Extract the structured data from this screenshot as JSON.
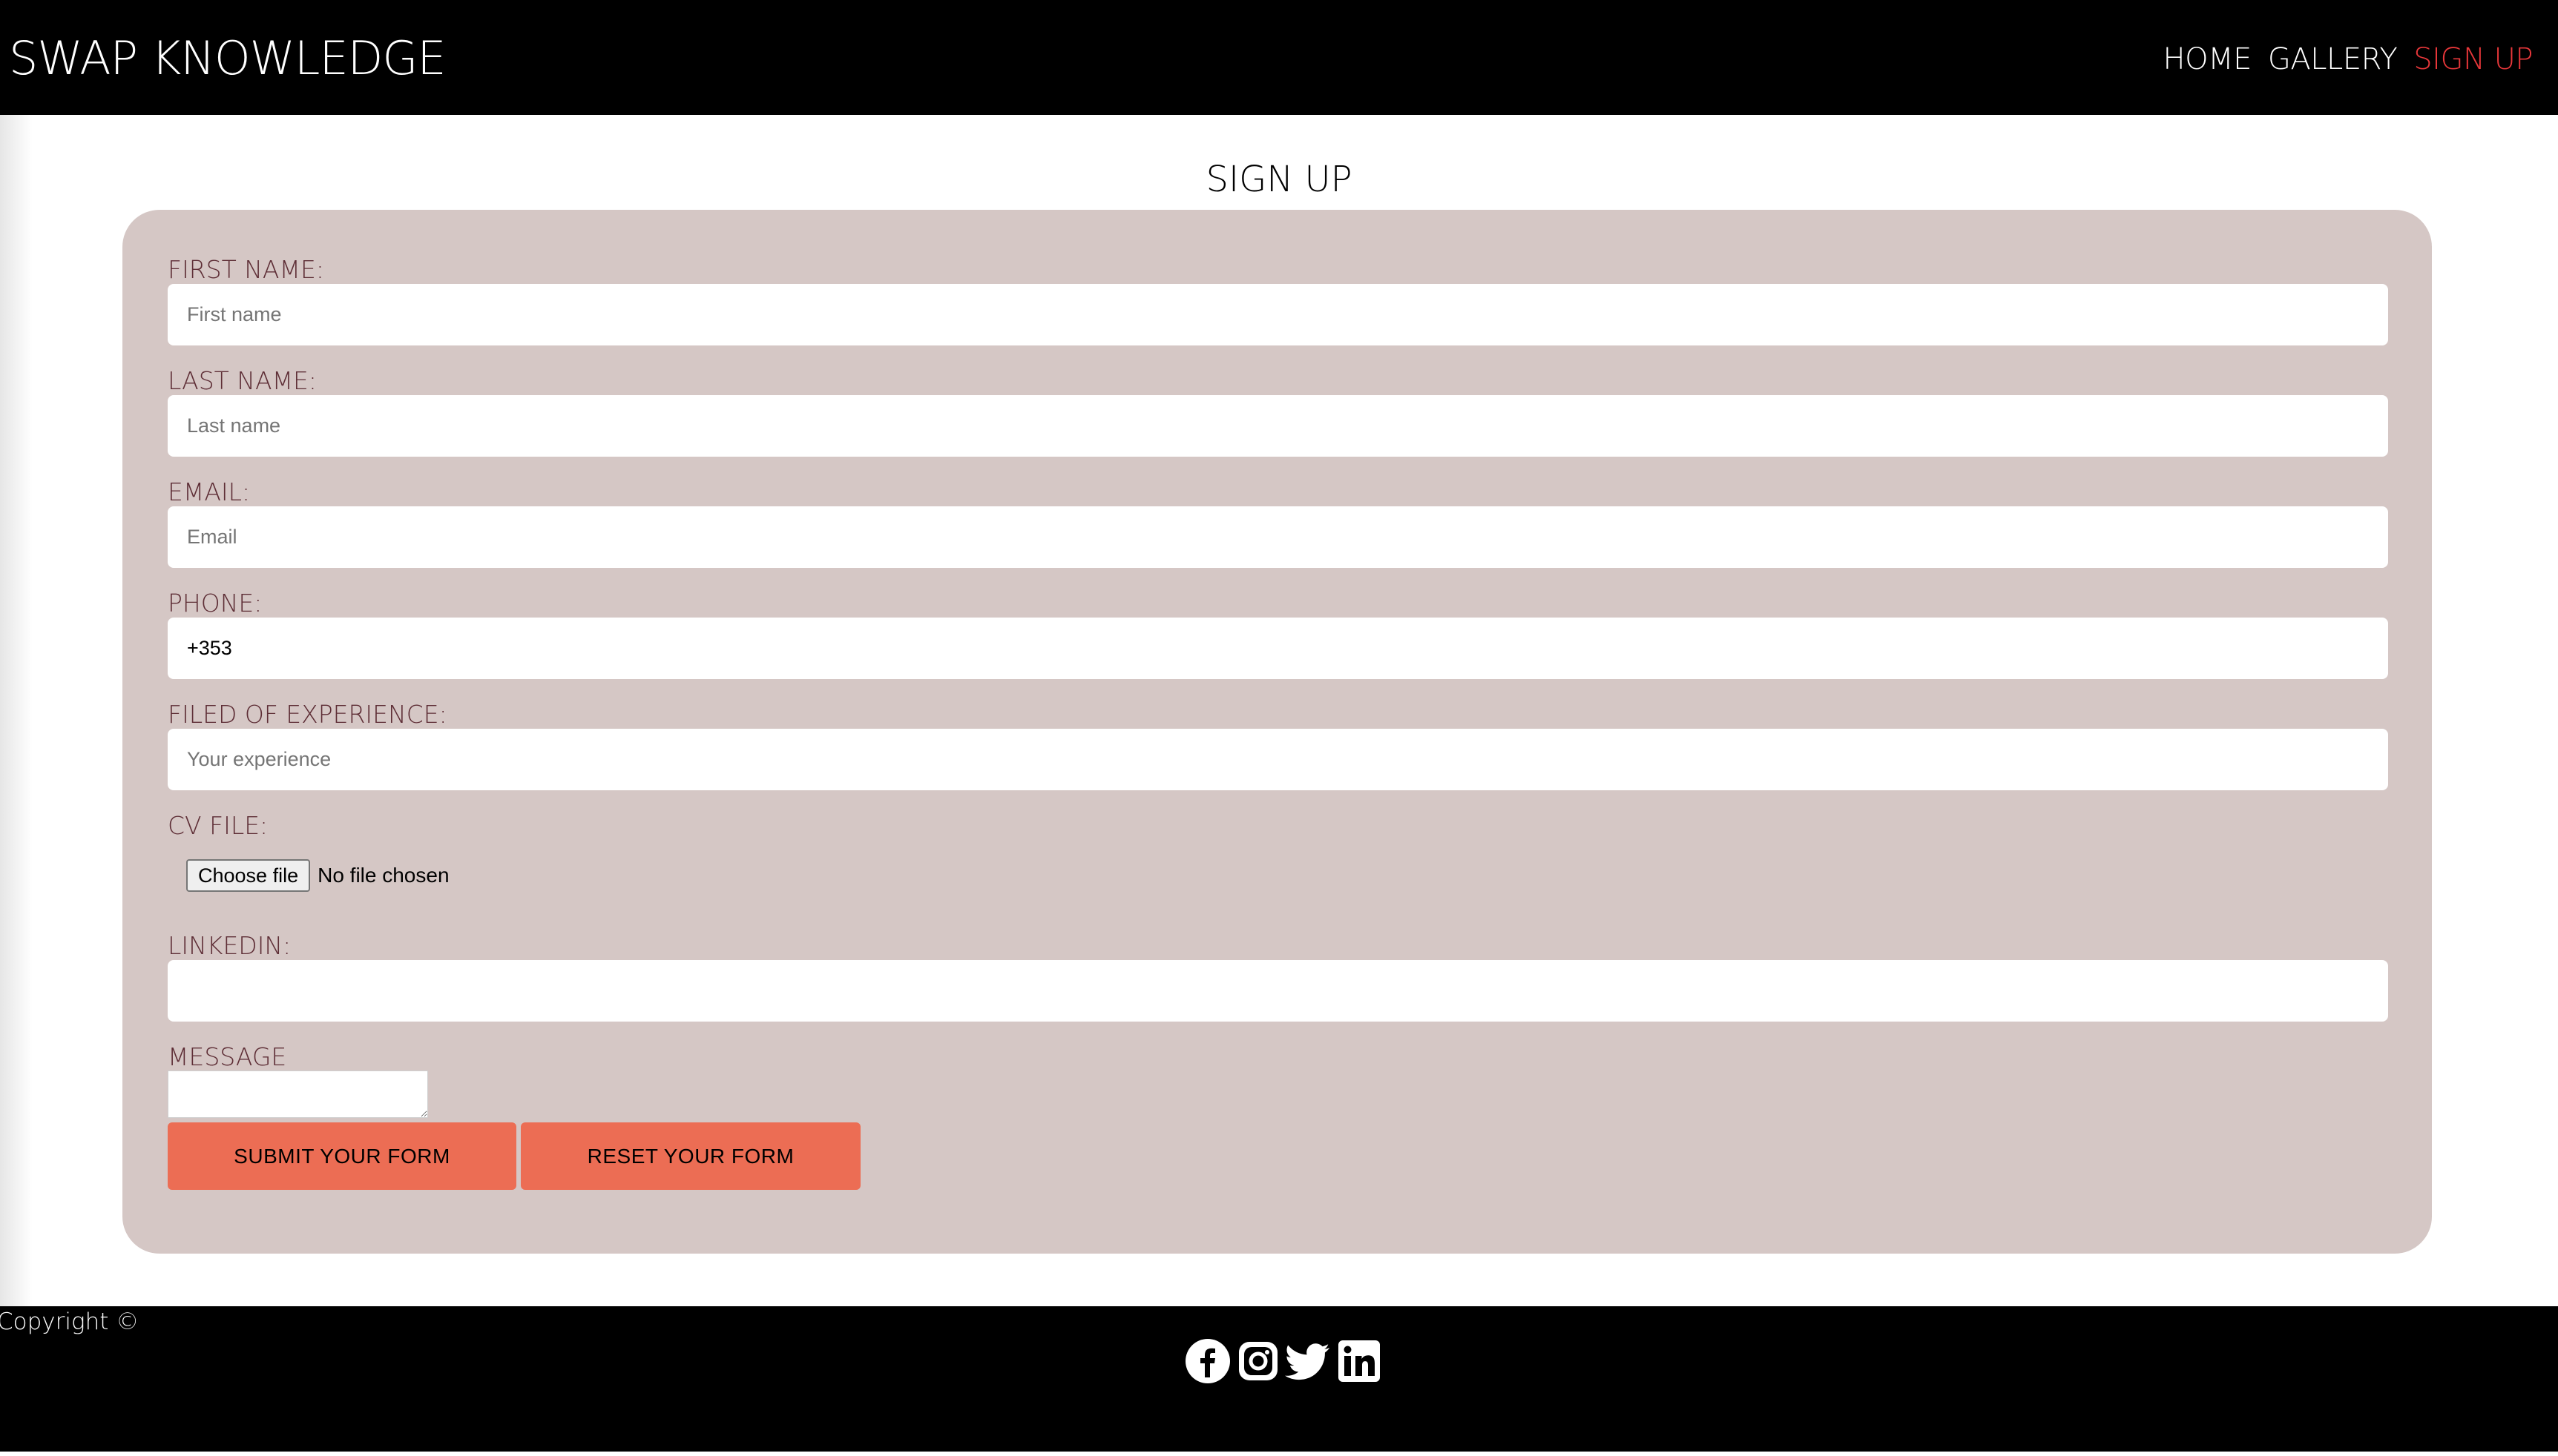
{
  "header": {
    "brand": "SWAP KNOWLEDGE",
    "nav": [
      {
        "label": "HOME",
        "active": false
      },
      {
        "label": "GALLERY",
        "active": false
      },
      {
        "label": "SIGN UP",
        "active": true
      }
    ]
  },
  "page_title": "SIGN UP",
  "form": {
    "first_name": {
      "label": "FIRST NAME:",
      "placeholder": "First name",
      "value": ""
    },
    "last_name": {
      "label": "LAST NAME:",
      "placeholder": "Last name",
      "value": ""
    },
    "email": {
      "label": "EMAIL:",
      "placeholder": "Email",
      "value": ""
    },
    "phone": {
      "label": "PHONE:",
      "placeholder": "",
      "value": "+353"
    },
    "experience": {
      "label": "FILED OF EXPERIENCE:",
      "placeholder": "Your experience",
      "value": ""
    },
    "cv_file": {
      "label": "CV FILE:",
      "button_label": "Choose file",
      "status": "No file chosen"
    },
    "linkedin": {
      "label": "LINKEDIN:",
      "placeholder": "",
      "value": ""
    },
    "message": {
      "label": "MESSAGE",
      "value": ""
    },
    "submit_label": "SUBMIT YOUR FORM",
    "reset_label": "RESET YOUR FORM"
  },
  "footer": {
    "copyright": "Copyright ©",
    "socials": [
      "facebook-icon",
      "instagram-icon",
      "twitter-icon",
      "linkedin-icon"
    ]
  },
  "colors": {
    "header_bg": "#000000",
    "accent_nav": "#e8373a",
    "form_bg": "#d5c7c5",
    "label_color": "#5e2e36",
    "button_bg": "#ec6d54"
  }
}
